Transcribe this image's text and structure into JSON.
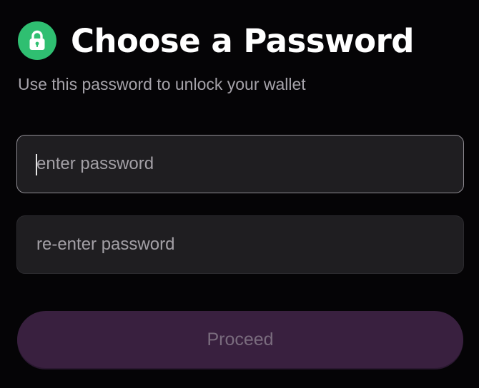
{
  "header": {
    "icon": "lock-icon",
    "title": "Choose a Password",
    "subtitle": "Use this password to unlock your wallet"
  },
  "form": {
    "password_placeholder": "enter password",
    "password_value": "",
    "confirm_placeholder": "re-enter password",
    "confirm_value": ""
  },
  "actions": {
    "proceed_label": "Proceed"
  },
  "colors": {
    "background": "#050406",
    "accent_green": "#2fbf71",
    "button_disabled": "#39203f"
  }
}
